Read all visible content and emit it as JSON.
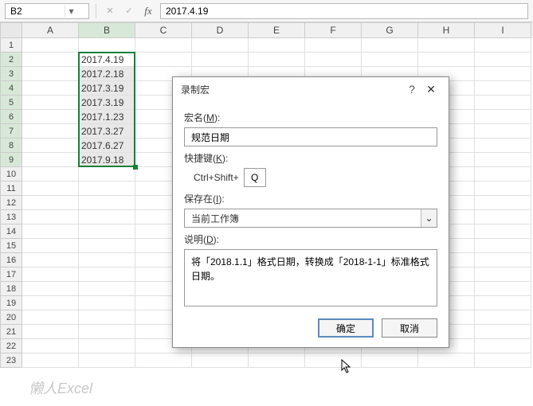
{
  "namebox": {
    "cell_ref": "B2"
  },
  "formula_bar": {
    "value": "2017.4.19",
    "fx": "fx"
  },
  "columns": [
    "A",
    "B",
    "C",
    "D",
    "E",
    "F",
    "G",
    "H",
    "I"
  ],
  "row_count": 23,
  "selected": {
    "col_idx": 1,
    "row_start": 2,
    "row_end": 9,
    "active_row": 2
  },
  "data_rows": [
    {
      "row": 2,
      "value": "2017.4.19"
    },
    {
      "row": 3,
      "value": "2017.2.18"
    },
    {
      "row": 4,
      "value": "2017.3.19"
    },
    {
      "row": 5,
      "value": "2017.3.19"
    },
    {
      "row": 6,
      "value": "2017.1.23"
    },
    {
      "row": 7,
      "value": "2017.3.27"
    },
    {
      "row": 8,
      "value": "2017.6.27"
    },
    {
      "row": 9,
      "value": "2017.9.18"
    }
  ],
  "dialog": {
    "title": "录制宏",
    "help": "?",
    "close": "✕",
    "name_label_pre": "宏名(",
    "name_label_u": "M",
    "name_label_post": "):",
    "name_value": "规范日期",
    "shortcut_label_pre": "快捷键(",
    "shortcut_label_u": "K",
    "shortcut_label_post": "):",
    "shortcut_prefix": "Ctrl+Shift+",
    "shortcut_key": "Q",
    "save_label_pre": "保存在(",
    "save_label_u": "I",
    "save_label_post": "):",
    "save_value": "当前工作簿",
    "desc_label_pre": "说明(",
    "desc_label_u": "D",
    "desc_label_post": "):",
    "desc_value": "将「2018.1.1」格式日期，转换成「2018-1-1」标准格式日期。",
    "ok": "确定",
    "cancel": "取消"
  },
  "watermark": "懒人Excel"
}
